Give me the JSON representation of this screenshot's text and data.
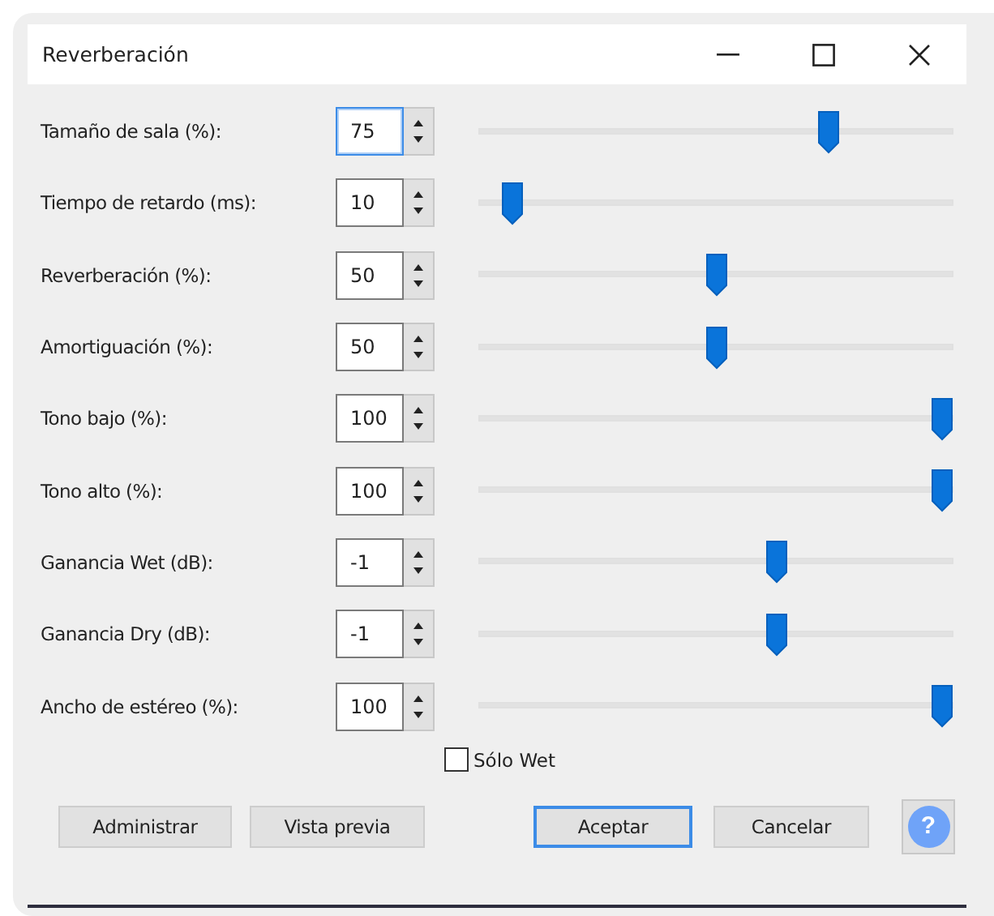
{
  "window": {
    "title": "Reverberación"
  },
  "params": [
    {
      "label": "Tamaño de sala (%):",
      "value": "75",
      "level": 0.75,
      "focused": true
    },
    {
      "label": "Tiempo de retardo (ms):",
      "value": "10",
      "level": 0.05,
      "focused": false
    },
    {
      "label": "Reverberación (%):",
      "value": "50",
      "level": 0.5,
      "focused": false
    },
    {
      "label": "Amortiguación (%):",
      "value": "50",
      "level": 0.5,
      "focused": false
    },
    {
      "label": "Tono bajo (%):",
      "value": "100",
      "level": 1,
      "focused": false
    },
    {
      "label": "Tono alto (%):",
      "value": "100",
      "level": 1,
      "focused": false
    },
    {
      "label": "Ganancia Wet (dB):",
      "value": "-1",
      "level": 0.633,
      "focused": false
    },
    {
      "label": "Ganancia Dry (dB):",
      "value": "-1",
      "level": 0.633,
      "focused": false
    },
    {
      "label": "Ancho de estéreo (%):",
      "value": "100",
      "level": 1,
      "focused": false
    }
  ],
  "checkbox": {
    "label": "Sólo Wet",
    "checked": false
  },
  "buttons": [
    {
      "kind": "text",
      "label": "Administrar",
      "default": false
    },
    {
      "kind": "text",
      "label": "Vista previa",
      "default": false
    },
    {
      "kind": "text",
      "label": "Aceptar",
      "default": true
    },
    {
      "kind": "text",
      "label": "Cancelar",
      "default": false
    },
    {
      "kind": "help",
      "label": "?"
    }
  ]
}
